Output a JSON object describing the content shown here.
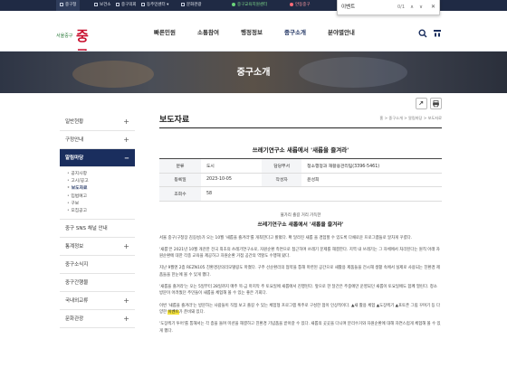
{
  "topbar": {
    "links": [
      "중구청",
      "보건소",
      "중구의회",
      "동주민센터",
      "문화관광",
      "중구교육지원센터",
      "안동중구"
    ]
  },
  "find": {
    "query": "이벤트",
    "count": "0/1",
    "prev": "∧",
    "next": "∨",
    "close": "✕"
  },
  "logo": {
    "small": "서울중구",
    "big": "중구"
  },
  "gnb": [
    "빠른민원",
    "소통참여",
    "행정정보",
    "중구소개",
    "분야별안내"
  ],
  "banner": {
    "title": "중구소개"
  },
  "sidebar": {
    "items": [
      "일반현황",
      "구정안내",
      "알림마당",
      "중구 SNS 채널 안내",
      "통계정보",
      "중구소식지",
      "중구간행물",
      "국내외교류",
      "문화관광"
    ],
    "plus": "+",
    "sub": [
      "공지사항",
      "고시/공고",
      "보도자료",
      "입법예고",
      "구보",
      "모집공고"
    ]
  },
  "content": {
    "title": "보도자료",
    "breadcrumb": "홈 > 중구소개 > 알림마당 > 보도자료",
    "article_title": "쓰레기연구소 새롭에서 '새롭을 즐겨라'",
    "info": {
      "l_category": "분류",
      "category": "도시",
      "l_dept": "담당부서",
      "dept": "청소행정과 재활용관리팀(3396-5461)",
      "l_date": "등록일",
      "date": "2023-10-05",
      "l_writer": "작성자",
      "writer": "윤성희",
      "l_views": "조회수",
      "views": "58"
    },
    "caption": "불가리 즐길 거리 가득한",
    "heading": "쓰레기연구소 새롭에서 '새롭을 즐겨라'",
    "p1": "서울 중구(구청장 김길성)가 오는 10월 '새롭을 즐겨라'를 개최한다고 밝혔다. 확 달라진 새롭 을 경험할 수 있도록 다채로운 프로그램들로 알차게 꾸렸다.",
    "p2": "'새롭'은 2021년 10월 개관한 전국 최초의 쓰레기연구소로, 자원순환 측면으로 접근하며 쓰레기 문제를 해결한다. 지역 내 쓰레기는 그 자체에서 처리된다는 원칙 아래 자원순환에 대한 각종 교육을 제공하고 자원순환 거점 공간의 역할도 수행해 왔다.",
    "p3": "지난 9월엔 2층 REZN105 친환경강의리모델링도 마쳤다. 구주 선순환리의 협약을 통해 마련된 공간으로 새활용 제품들을 전시해 생활 속에서 실제로 사용되는 친환경 제품들을 한눈에 볼 수 있게 했다.",
    "p4": "'새롭을 즐겨라'는 오는 5일부터 28일까지 매주 목·금 마지막 주 토요일에 새롭에서 진행된다. 앞으로 한 달간은 주중에만 운영되던 새롭이 토요일에도 함께 열린다. 청소 방문이 어려웠던 주민들이 새롭을 체험해 볼 수 있는 좋은 기회다.",
    "p5a": "이번 '새롭을 즐겨라'는 방문하는 사람들이 직접 보고 즐길 수 있는 체험형 프로그램 위주로 구성한 점이 인상적이다. ▲새 활용 체험 ▲도장찍기 ▲포토존 그림 꾸며기 등 다양한 ",
    "p5hl": "이벤트",
    "p5b": "가 준비돼 있다.",
    "p6": "'도장찍기 투어'를 통해서는 각 층을 돌며 미션을 해결하고 친환경 기념품을 받아갈 수 있다. 새롭의 곳곳을 다니며 분리수거와 자원순환에 대해 자연스럽게 체험해 볼 수 있게 했다."
  },
  "colors": {
    "navy": "#1a2e5e",
    "topbar": "#1f2a44",
    "highlight": "#f4e23a",
    "logo_red": "#c8102e"
  }
}
